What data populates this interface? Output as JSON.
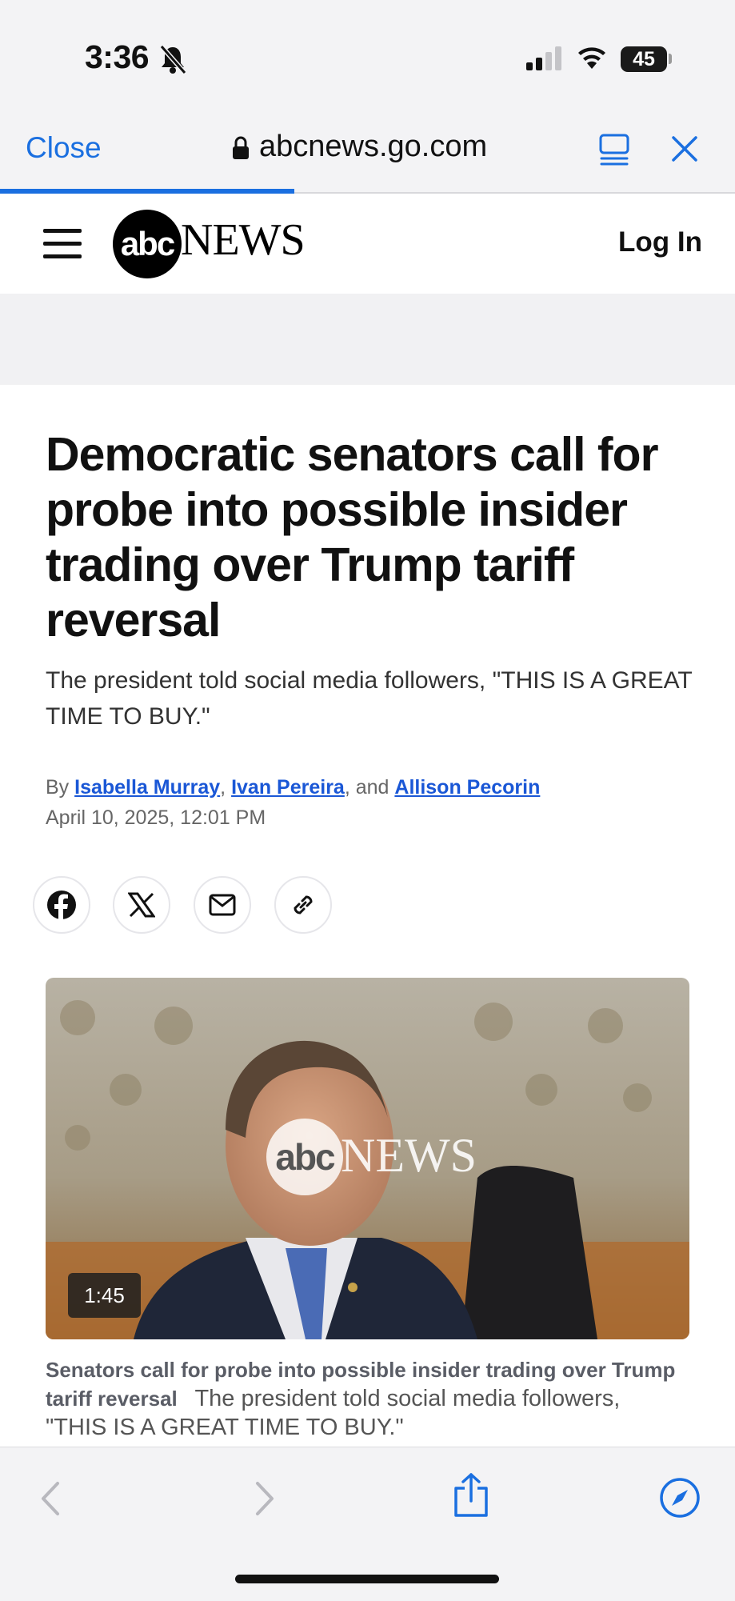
{
  "status_bar": {
    "time": "3:36",
    "battery": "45"
  },
  "browser": {
    "close_label": "Close",
    "url": "abcnews.go.com"
  },
  "site": {
    "login_label": "Log In",
    "logo_abc": "abc",
    "logo_news": "NEWS"
  },
  "article": {
    "headline": "Democratic senators call for probe into possible insider trading over Trump tariff reversal",
    "deck": "The president told social media followers, \"THIS IS A GREAT TIME TO BUY.\"",
    "byline_prefix": "By ",
    "authors": [
      "Isabella Murray",
      "Ivan Pereira",
      "Allison Pecorin"
    ],
    "sep_comma": ", ",
    "sep_and": ", and ",
    "date": "April 10, 2025, 12:01 PM"
  },
  "share": [
    "facebook-icon",
    "x-icon",
    "mail-icon",
    "link-icon"
  ],
  "video": {
    "duration": "1:45",
    "caption_title": "Senators call for probe into possible insider trading over Trump tariff reversal",
    "caption_desc": "The president told social media followers, \"THIS IS A GREAT TIME TO BUY.\""
  },
  "colors": {
    "accent": "#1a6fe0",
    "link": "#1a57d6"
  }
}
